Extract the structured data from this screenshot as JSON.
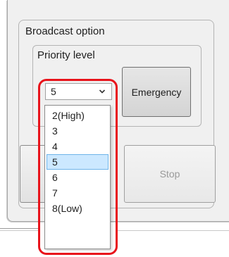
{
  "broadcast_group": {
    "title": "Broadcast option"
  },
  "priority_group": {
    "title": "Priority level",
    "selected_value": "5",
    "options": [
      "2(High)",
      "3",
      "4",
      "5",
      "6",
      "7",
      "8(Low)"
    ]
  },
  "buttons": {
    "emergency_label": "Emergency",
    "left_label": "",
    "stop_label": "Stop"
  },
  "icons": {
    "combo_arrow": "chevron-down-icon"
  },
  "colors": {
    "highlight": "#e8131b",
    "selected_item_bg": "#cce8ff",
    "selected_item_border": "#6fb4e8",
    "disabled_text": "#9a9a9a"
  }
}
